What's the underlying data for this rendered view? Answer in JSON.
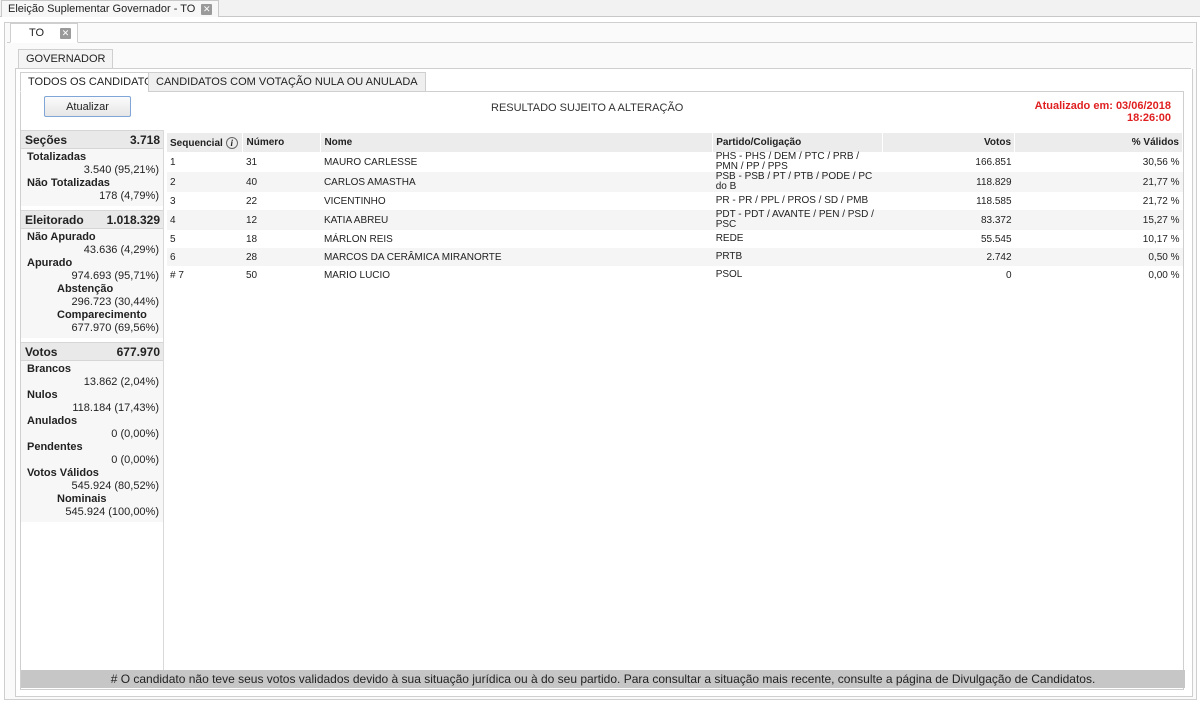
{
  "window": {
    "title": "Eleição Suplementar Governador - TO"
  },
  "state_tab": {
    "label": "TO"
  },
  "cargo_tab": {
    "label": "GOVERNADOR"
  },
  "candidate_tabs": [
    {
      "label": "TODOS OS CANDIDATOS",
      "active": true
    },
    {
      "label": "CANDIDATOS COM VOTAÇÃO NULA OU ANULADA",
      "active": false
    }
  ],
  "toolbar": {
    "refresh_label": "Atualizar",
    "notice": "RESULTADO SUJEITO A ALTERAÇÃO",
    "updated_line1": "Atualizado em: 03/06/2018",
    "updated_line2": "18:26:00"
  },
  "sidebar": {
    "secoes": {
      "label": "Seções",
      "value": "3.718"
    },
    "totalizadas": {
      "label": "Totalizadas",
      "value": "3.540 (95,21%)"
    },
    "nao_totalizadas": {
      "label": "Não Totalizadas",
      "value": "178 (4,79%)"
    },
    "eleitorado": {
      "label": "Eleitorado",
      "value": "1.018.329"
    },
    "nao_apurado": {
      "label": "Não Apurado",
      "value": "43.636 (4,29%)"
    },
    "apurado": {
      "label": "Apurado",
      "value": "974.693 (95,71%)"
    },
    "abstencao": {
      "label": "Abstenção",
      "value": "296.723 (30,44%)"
    },
    "comparecimento": {
      "label": "Comparecimento",
      "value": "677.970 (69,56%)"
    },
    "votos": {
      "label": "Votos",
      "value": "677.970"
    },
    "brancos": {
      "label": "Brancos",
      "value": "13.862 (2,04%)"
    },
    "nulos": {
      "label": "Nulos",
      "value": "118.184 (17,43%)"
    },
    "anulados": {
      "label": "Anulados",
      "value": "0 (0,00%)"
    },
    "pendentes": {
      "label": "Pendentes",
      "value": "0 (0,00%)"
    },
    "votos_validos": {
      "label": "Votos Válidos",
      "value": "545.924 (80,52%)"
    },
    "nominais": {
      "label": "Nominais",
      "value": "545.924 (100,00%)"
    }
  },
  "table": {
    "headers": {
      "sequencial": "Sequencial",
      "numero": "Número",
      "nome": "Nome",
      "partido": "Partido/Coligação",
      "votos": "Votos",
      "validos": "% Válidos"
    },
    "rows": [
      {
        "seq": "1",
        "numero": "31",
        "nome": "MAURO CARLESSE",
        "partido": "PHS - PHS / DEM / PTC / PRB / PMN / PP / PPS",
        "votos": "166.851",
        "validos": "30,56 %"
      },
      {
        "seq": "2",
        "numero": "40",
        "nome": "CARLOS AMASTHA",
        "partido": "PSB - PSB / PT / PTB / PODE / PC do B",
        "votos": "118.829",
        "validos": "21,77 %"
      },
      {
        "seq": "3",
        "numero": "22",
        "nome": "VICENTINHO",
        "partido": "PR - PR / PPL / PROS / SD / PMB",
        "votos": "118.585",
        "validos": "21,72 %"
      },
      {
        "seq": "4",
        "numero": "12",
        "nome": "KATIA ABREU",
        "partido": "PDT - PDT / AVANTE / PEN / PSD / PSC",
        "votos": "83.372",
        "validos": "15,27 %"
      },
      {
        "seq": "5",
        "numero": "18",
        "nome": "MÁRLON REIS",
        "partido": "REDE",
        "votos": "55.545",
        "validos": "10,17 %"
      },
      {
        "seq": "6",
        "numero": "28",
        "nome": "MARCOS DA CERÂMICA MIRANORTE",
        "partido": "PRTB",
        "votos": "2.742",
        "validos": "0,50 %"
      },
      {
        "seq": "# 7",
        "numero": "50",
        "nome": "MARIO LUCIO",
        "partido": "PSOL",
        "votos": "0",
        "validos": "0,00 %"
      }
    ]
  },
  "footer": {
    "note": "# O candidato não teve seus votos validados devido à sua situação jurídica ou à do seu partido. Para consultar a situação mais recente, consulte a página de Divulgação de Candidatos."
  }
}
